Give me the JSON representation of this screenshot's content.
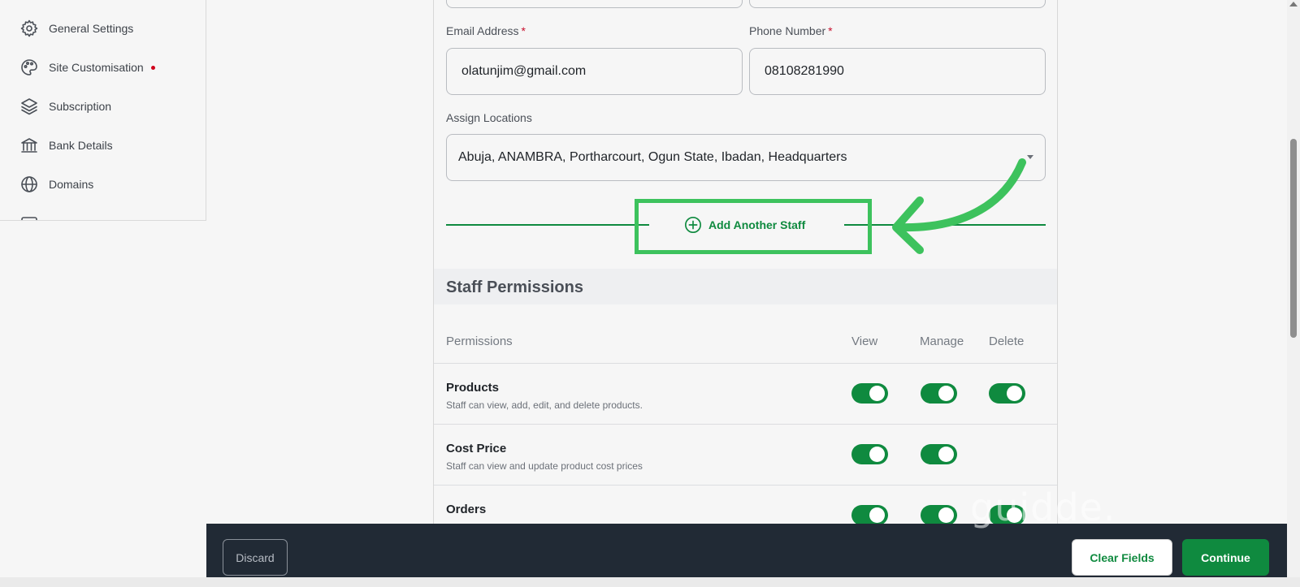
{
  "sidebar": {
    "items": [
      {
        "label": "General Settings",
        "icon": "gear-icon"
      },
      {
        "label": "Site Customisation",
        "icon": "palette-icon",
        "badge": "red-dot"
      },
      {
        "label": "Subscription",
        "icon": "layers-icon"
      },
      {
        "label": "Bank Details",
        "icon": "bank-icon"
      },
      {
        "label": "Domains",
        "icon": "globe-icon"
      }
    ]
  },
  "form": {
    "email_label": "Email Address",
    "email_value": "olatunjim@gmail.com",
    "phone_label": "Phone Number",
    "phone_value": "08108281990",
    "required_marker": "*",
    "locations_label": "Assign Locations",
    "locations_value": "Abuja, ANAMBRA, Portharcourt, Ogun State, Ibadan, Headquarters",
    "add_staff_label": "Add Another Staff"
  },
  "permissions": {
    "title": "Staff Permissions",
    "columns": [
      "Permissions",
      "View",
      "Manage",
      "Delete"
    ],
    "rows": [
      {
        "name": "Products",
        "description": "Staff can view, add, edit, and delete products.",
        "view": true,
        "manage": true,
        "delete": true
      },
      {
        "name": "Cost Price",
        "description": "Staff can view and update product cost prices",
        "view": true,
        "manage": true
      },
      {
        "name": "Orders",
        "description": "",
        "view": true,
        "manage": true,
        "delete": true
      }
    ]
  },
  "footer": {
    "discard_label": "Discard",
    "clear_label": "Clear Fields",
    "continue_label": "Continue"
  },
  "watermark": "guidde.",
  "colors": {
    "accent": "#0f8a3f",
    "highlight": "#3dc25d",
    "bottom_bar": "#212a35",
    "required": "#c8102e"
  }
}
